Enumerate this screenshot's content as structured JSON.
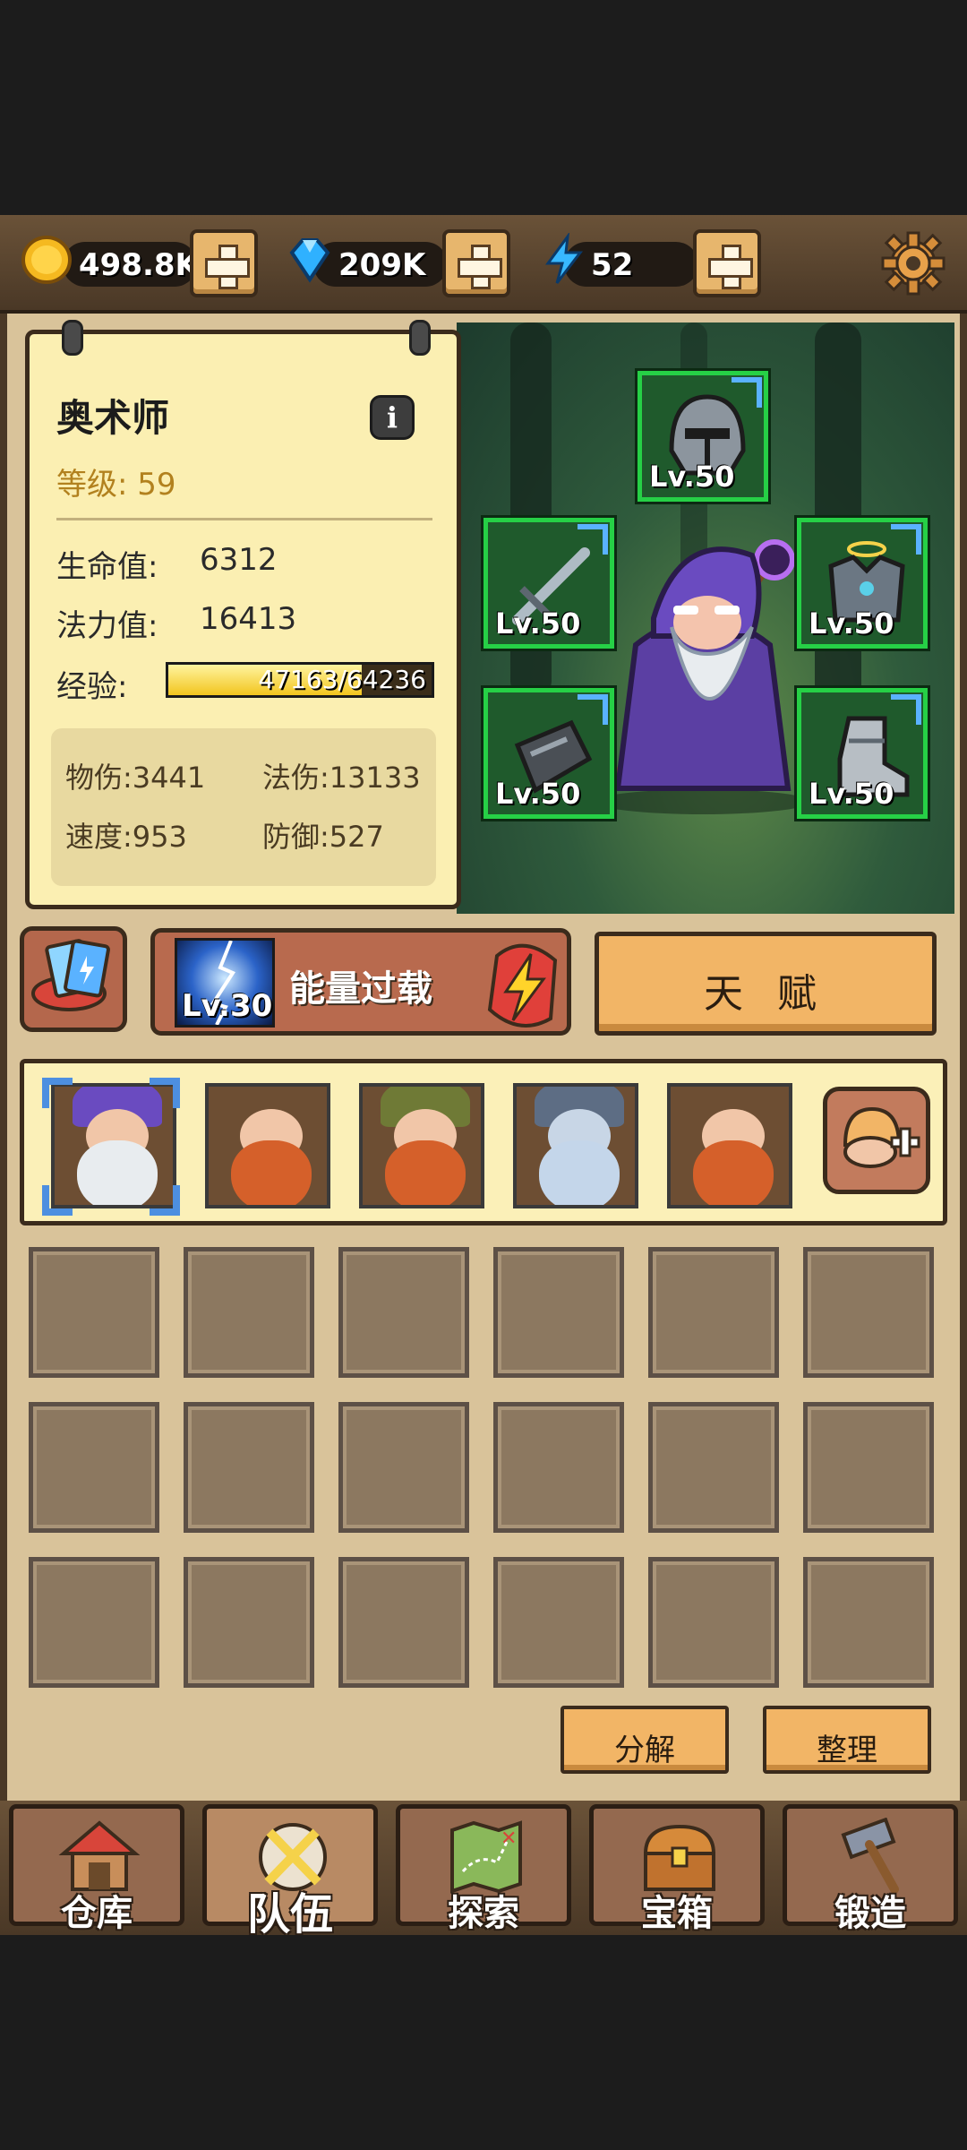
{
  "resources": {
    "gold": "498.8K",
    "diamonds": "209K",
    "energy": "52"
  },
  "hero": {
    "name": "奥术师",
    "level_label": "等级:",
    "level": "59",
    "hp_label": "生命值:",
    "hp": "6312",
    "mp_label": "法力值:",
    "mp": "16413",
    "exp_label": "经验:",
    "exp": "47163/64236",
    "exp_fraction": 0.734,
    "physical_damage": "物伤:3441",
    "magic_damage": "法伤:13133",
    "speed": "速度:953",
    "defense": "防御:527"
  },
  "equipment": [
    {
      "slot": "helmet",
      "level": "Lv.50"
    },
    {
      "slot": "weapon",
      "level": "Lv.50"
    },
    {
      "slot": "armor",
      "level": "Lv.50"
    },
    {
      "slot": "bracer",
      "level": "Lv.50"
    },
    {
      "slot": "boots",
      "level": "Lv.50"
    }
  ],
  "skill": {
    "level": "Lv.30",
    "name": "能量过载"
  },
  "talent_label": "天 赋",
  "team": [
    "arcanist",
    "dwarf-red",
    "dwarf-hood",
    "dwarf-viking",
    "dwarf-red"
  ],
  "inventory_slots": 18,
  "actions": {
    "decompose": "分解",
    "sort": "整理"
  },
  "nav": [
    {
      "label": "仓库",
      "icon": "house-icon"
    },
    {
      "label": "队伍",
      "icon": "crossed-swords-icon"
    },
    {
      "label": "探索",
      "icon": "map-icon"
    },
    {
      "label": "宝箱",
      "icon": "chest-icon"
    },
    {
      "label": "锻造",
      "icon": "hammer-icon"
    }
  ],
  "colors": {
    "equip_border": "#26d046",
    "selection": "#4d8fe0",
    "exp_bar": "#f2c51e",
    "button": "#f2b566"
  }
}
